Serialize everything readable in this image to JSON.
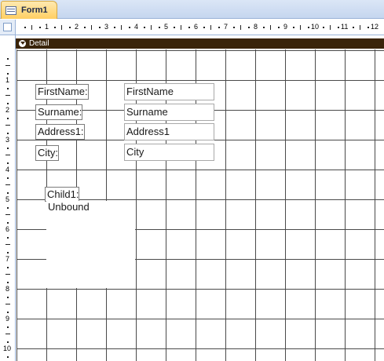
{
  "tab": {
    "title": "Form1",
    "icon": "form-icon"
  },
  "section": {
    "label": "Detail",
    "icon": "section-collapse-icon"
  },
  "ruler": {
    "horizontal_numbers": [
      "1",
      "2",
      "3",
      "4",
      "5",
      "6",
      "7",
      "8",
      "9",
      "10",
      "11",
      "12"
    ],
    "vertical_numbers": [
      "1",
      "2",
      "3",
      "4",
      "5",
      "6",
      "7",
      "8",
      "9",
      "10"
    ]
  },
  "fields": [
    {
      "label": "FirstName:",
      "textbox": "FirstName"
    },
    {
      "label": "Surname:",
      "textbox": "Surname"
    },
    {
      "label": "Address1:",
      "textbox": "Address1"
    },
    {
      "label": "City:",
      "textbox": "City"
    }
  ],
  "subform": {
    "label": "Child1:",
    "source": "Unbound"
  }
}
